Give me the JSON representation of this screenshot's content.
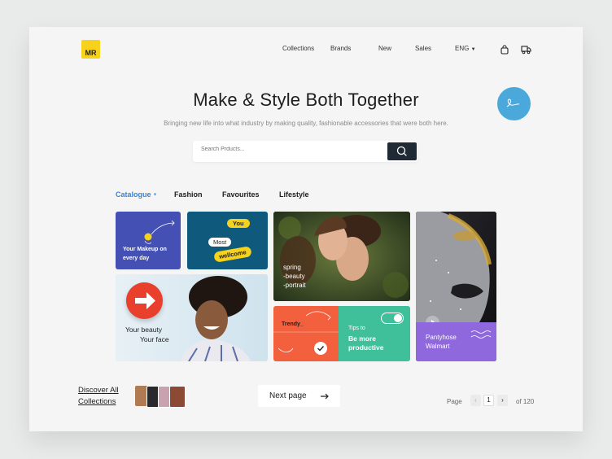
{
  "brand": {
    "logo_text": "MR",
    "logo_color": "#f7d21c"
  },
  "nav": {
    "items": [
      "Collections",
      "Brands",
      "New",
      "Sales"
    ],
    "language": "ENG",
    "icons": [
      "shopping-bag-icon",
      "delivery-truck-icon"
    ]
  },
  "hero": {
    "title": "Make & Style Both Together",
    "subtitle": "Bringing new life into what industry by making quality, fashionable accessories that were both here."
  },
  "search": {
    "placeholder": "Search Prducts...",
    "button_icon": "search-icon"
  },
  "tabs": {
    "active": "Catalogue",
    "items": [
      "Catalogue",
      "Fashion",
      "Favourites",
      "Lifestyle"
    ]
  },
  "tiles": {
    "makeup": {
      "text": "Your Makeup on every day"
    },
    "welcome": {
      "word1": "You",
      "word2": "Most",
      "word3": "wellcome"
    },
    "portrait": {
      "line1": "spring",
      "line2": "-beauty",
      "line3": "-portrait"
    },
    "beauty": {
      "line1": "Your beauty",
      "line2": "Your face"
    },
    "trendy": {
      "text": "Trendy_"
    },
    "tips": {
      "line1": "Tips to",
      "line2": "Be more",
      "line3": "productive"
    },
    "pantyhose": {
      "line1": "Pantyhose",
      "line2": "Walmart"
    }
  },
  "footer": {
    "discover_line1": "Discover All",
    "discover_line2": "Collections",
    "next_label": "Next page",
    "page_label": "Page",
    "page_current": "1",
    "page_total": "of 120"
  },
  "colors": {
    "accent_blue": "#3b82d6",
    "tile_purple": "#4450b4",
    "tile_navy": "#0f5a7c",
    "tile_orange": "#f2603e",
    "tile_green": "#3fbf9a",
    "tile_lilac": "#8e68dc",
    "circle_blue": "#4ba8da"
  }
}
